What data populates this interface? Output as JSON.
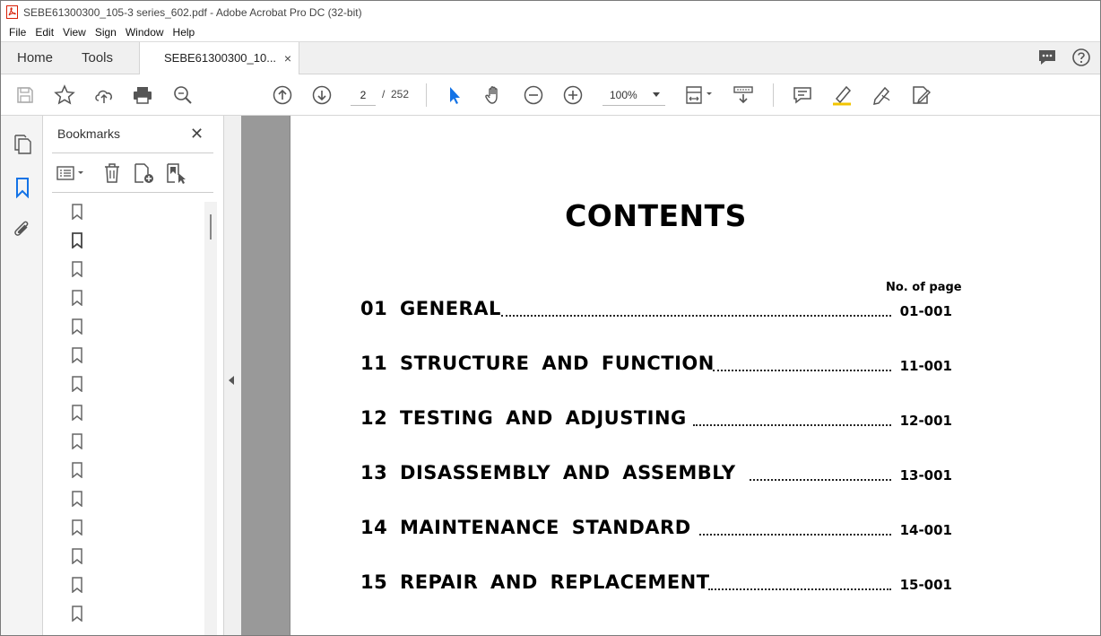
{
  "window": {
    "title": "SEBE61300300_105-3 series_602.pdf - Adobe Acrobat Pro DC (32-bit)"
  },
  "menu": [
    "File",
    "Edit",
    "View",
    "Sign",
    "Window",
    "Help"
  ],
  "tabs": {
    "home": "Home",
    "tools": "Tools",
    "document": "SEBE61300300_10...",
    "close": "×"
  },
  "toolbar": {
    "page_current": "2",
    "page_separator": "/",
    "page_total": "252",
    "zoom": "100%"
  },
  "bookmarks": {
    "header": "Bookmarks",
    "close": "✕",
    "item_count": 15
  },
  "document": {
    "title": "CONTENTS",
    "no_of_page_label": "No. of page",
    "toc": [
      {
        "label": "01 GENERAL",
        "page": "01-001"
      },
      {
        "label": "11 STRUCTURE AND FUNCTION",
        "page": "11-001"
      },
      {
        "label": "12 TESTING AND ADJUSTING",
        "page": "12-001"
      },
      {
        "label": "13 DISASSEMBLY AND ASSEMBLY",
        "page": "13-001"
      },
      {
        "label": "14 MAINTENANCE STANDARD",
        "page": "14-001"
      },
      {
        "label": "15 REPAIR AND REPLACEMENT",
        "page": "15-001"
      }
    ]
  },
  "colors": {
    "accent_blue": "#1473e6",
    "pdf_red": "#d81e05",
    "icon_gray": "#555555"
  }
}
